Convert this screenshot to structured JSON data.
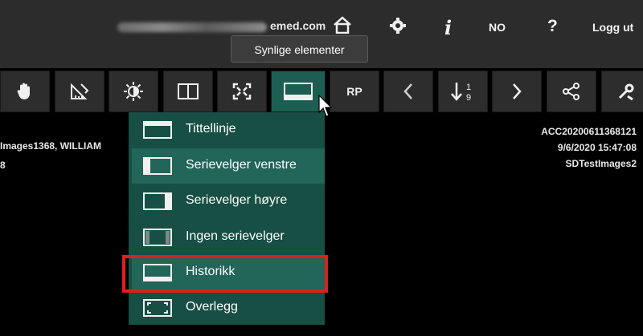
{
  "header": {
    "email_visible_tail": "emed.com",
    "language": "NO",
    "logout": "Logg ut",
    "icons": [
      "home-icon",
      "gear-icon",
      "info-icon",
      "help-icon"
    ],
    "info_glyph": "i",
    "help_glyph": "?"
  },
  "tooltip": {
    "text": "Synlige elementer"
  },
  "toolbar": {
    "buttons": [
      "hand-pan-icon",
      "measure-ruler-icon",
      "brightness-icon",
      "split-view-icon",
      "fullscreen-icon",
      "layout-visible-elements-icon",
      "rp",
      "chevron-left-icon",
      "sort-number-icon",
      "chevron-right-icon",
      "share-icon",
      "tools-icon"
    ],
    "rp_label": "RP"
  },
  "patient_info": {
    "left_line1": "Images1368, WILLIAM",
    "left_line2": "8"
  },
  "study_info": {
    "accession": "ACC20200611368121",
    "datetime": "9/6/2020 15:47:08",
    "institution": "SDTestImages2"
  },
  "menu": {
    "items": [
      {
        "label": "Tittellinje",
        "icon": "title-bar-layout-icon"
      },
      {
        "label": "Serievelger venstre",
        "icon": "series-left-layout-icon"
      },
      {
        "label": "Serievelger høyre",
        "icon": "series-right-layout-icon"
      },
      {
        "label": "Ingen serievelger",
        "icon": "no-series-layout-icon"
      },
      {
        "label": "Historikk",
        "icon": "history-bottom-layout-icon"
      },
      {
        "label": "Overlegg",
        "icon": "overlay-corners-icon"
      }
    ],
    "highlighted_item": "Historikk"
  },
  "colors": {
    "topbar": "#2c2c2c",
    "toolbar_button": "#2d2d2d",
    "active_button": "#1d5e52",
    "menu_bg": "#174f44",
    "menu_alt_bg": "#226559",
    "highlight_border": "#e01e1e"
  }
}
